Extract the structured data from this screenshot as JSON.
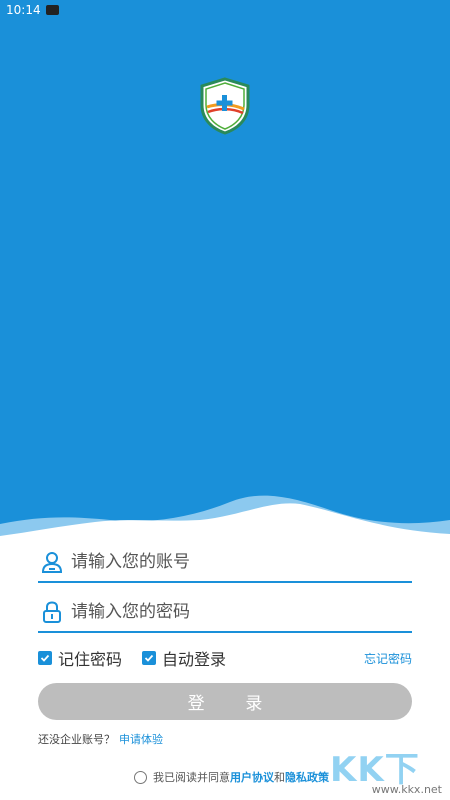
{
  "status_bar": {
    "time": "10:14"
  },
  "login": {
    "account_placeholder": "请输入您的账号",
    "password_placeholder": "请输入您的密码",
    "remember_password": "记住密码",
    "auto_login": "自动登录",
    "forgot_password": "忘记密码",
    "login_button": "登 录",
    "no_account_text": "还没企业账号？",
    "apply_trial": "申请体验",
    "agree_prefix": "我已阅读并同意",
    "user_agreement": "用户协议",
    "and_text": "和",
    "privacy_policy": "隐私政策"
  },
  "checkboxes": {
    "remember_checked": true,
    "auto_login_checked": true
  },
  "watermark": {
    "logo_text": "KK下载",
    "url": "www.kkx.net"
  },
  "colors": {
    "primary": "#1a90d9",
    "button_disabled": "#bdbdbd",
    "wave_light": "#8cc9ef"
  },
  "icons": [
    "shield-logo-icon",
    "user-icon",
    "lock-icon",
    "checkbox-checked-icon",
    "radio-unchecked-icon"
  ]
}
